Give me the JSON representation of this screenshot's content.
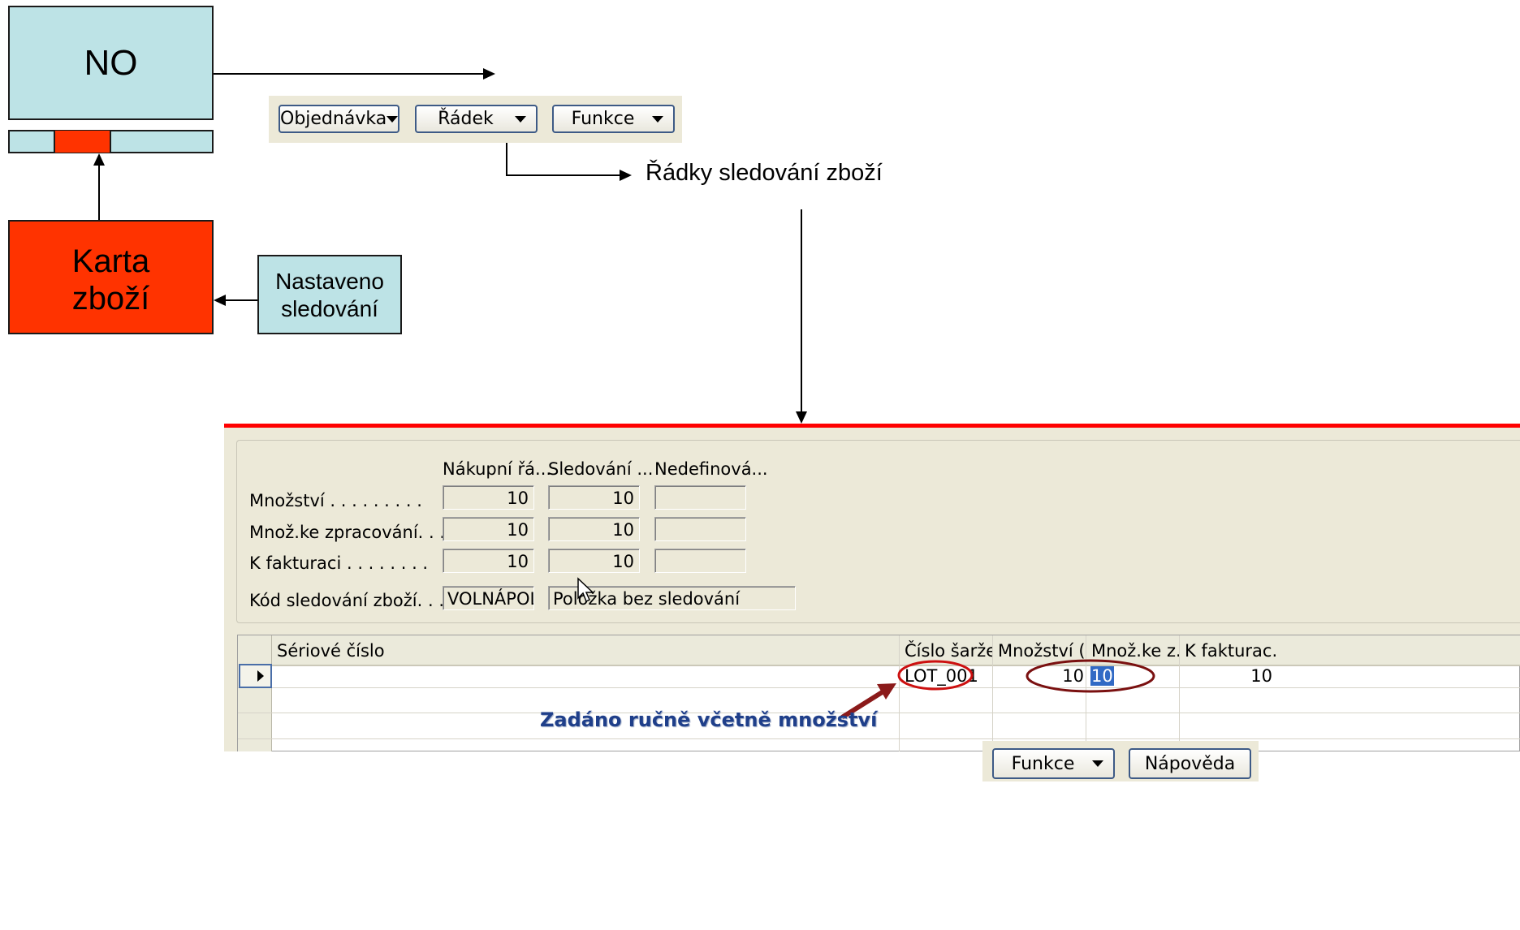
{
  "diagram": {
    "no_box": "NO",
    "item_card": [
      "Karta",
      "zboží"
    ],
    "tracking_set": [
      "Nastaveno",
      "sledování"
    ],
    "tracking_lines": "Řádky sledování zboží",
    "annotation": "Zadáno ručně včetně množství"
  },
  "toolbar": {
    "order_label": "Objednávka",
    "line_label": "Řádek",
    "functions_label": "Funkce"
  },
  "form": {
    "col_headers": [
      "Nákupní řá...",
      "Sledování ...",
      "Nedefinová..."
    ],
    "rows": [
      {
        "label": "Množství . . . . . . . . .",
        "values": [
          "10",
          "10",
          ""
        ]
      },
      {
        "label": "Množ.ke zpracování. . . .",
        "values": [
          "10",
          "10",
          ""
        ]
      },
      {
        "label": "K fakturaci . . . . . . . .",
        "values": [
          "10",
          "10",
          ""
        ]
      }
    ],
    "tracking_code_label": "Kód sledování zboží. . . .",
    "tracking_code_value": "VOLNÁPOL",
    "tracking_code_desc": "Položka bez sledování"
  },
  "table": {
    "columns": [
      "Sériové číslo",
      "Číslo šarže",
      "Množství (...",
      "Množ.ke z...",
      "K fakturac..."
    ],
    "rows": [
      {
        "serial": "",
        "lot": "LOT_001",
        "qty": "10",
        "qty_handle": "10",
        "qty_invoice": "10"
      }
    ]
  },
  "footer": {
    "functions_label": "Funkce",
    "help_label": "Nápověda"
  },
  "colors": {
    "cyan_box": "#bde3e6",
    "red_box": "#ff3300",
    "separator": "#ff0000",
    "annotation_text": "#1f3f8a",
    "ellipse": "#cc1010",
    "arrow": "#8b1a1a"
  }
}
